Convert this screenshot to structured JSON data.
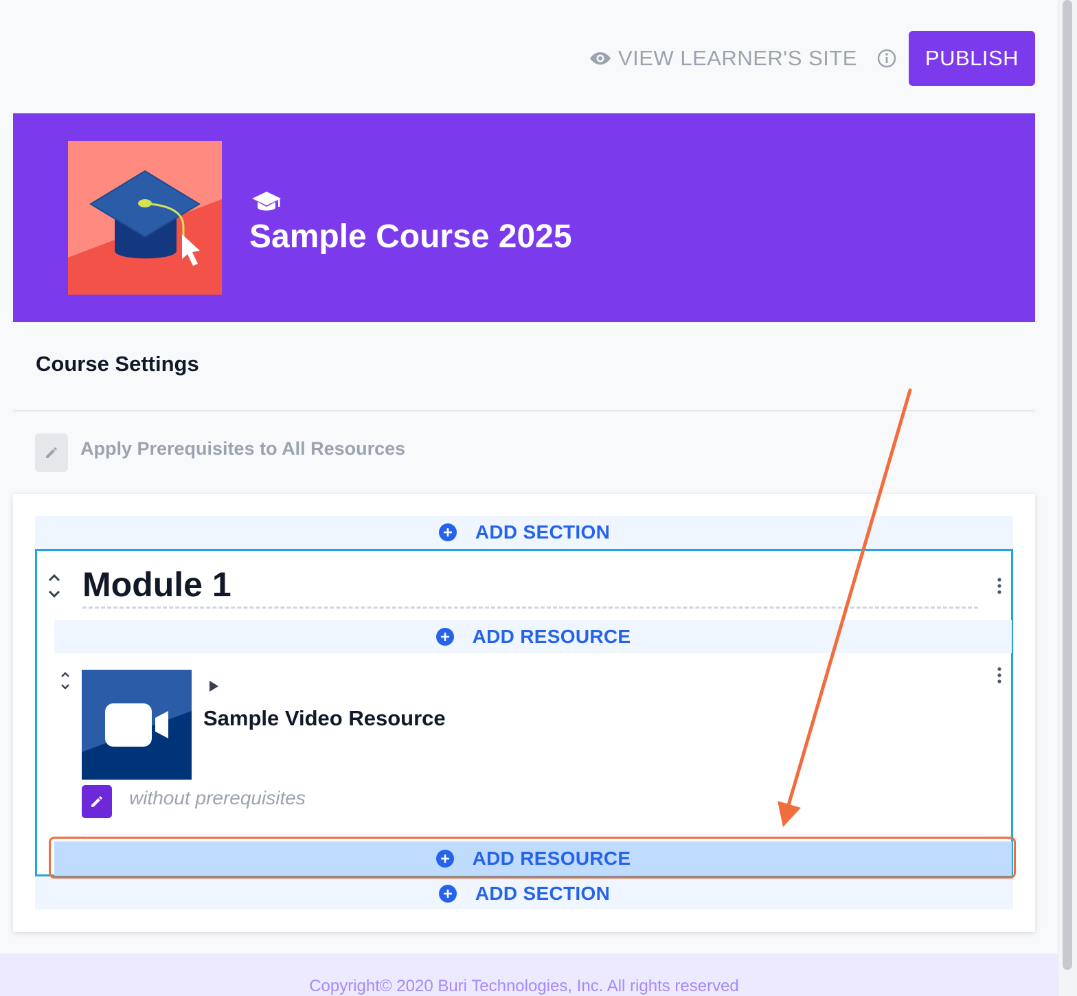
{
  "topbar": {
    "view_label": "VIEW LEARNER'S SITE",
    "view_icon": "eye-icon",
    "info_icon": "info-icon",
    "publish_label": "PUBLISH"
  },
  "course": {
    "title": "Sample Course 2025",
    "type_icon": "graduation-cap-icon",
    "banner_color": "#7c3aed"
  },
  "settings": {
    "title": "Course Settings",
    "apply_prereq_label": "Apply Prerequisites to All Resources"
  },
  "outline": {
    "add_section_label": "ADD SECTION",
    "add_resource_label": "ADD RESOURCE",
    "module": {
      "title": "Module 1",
      "resources": [
        {
          "title": "Sample Video Resource",
          "type_icon": "video-camera-icon",
          "prereq_text": "without prerequisites"
        }
      ]
    }
  },
  "colors": {
    "accent": "#7c3aed",
    "link": "#2563eb",
    "selection_border": "#1ea7e1",
    "annotation": "#f26d3d"
  },
  "footer": {
    "copyright": "Copyright© 2020 Buri Technologies, Inc. All rights reserved"
  }
}
